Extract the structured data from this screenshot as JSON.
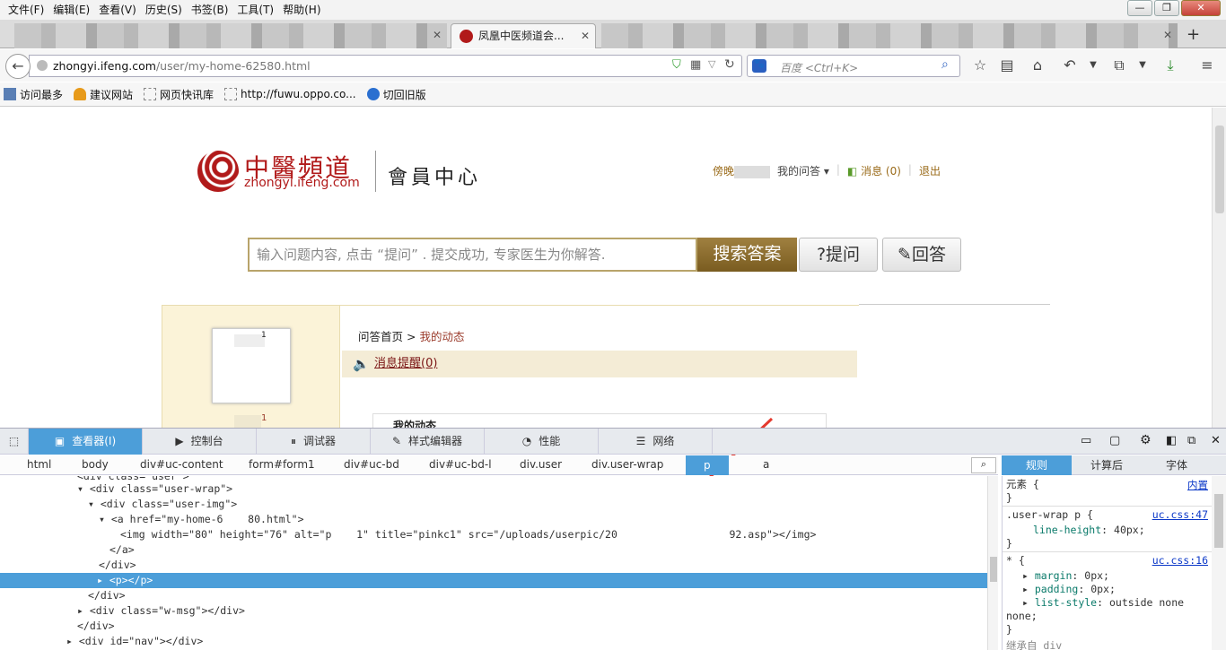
{
  "menubar": {
    "items": [
      "文件(F)",
      "编辑(E)",
      "查看(V)",
      "历史(S)",
      "书签(B)",
      "工具(T)",
      "帮助(H)"
    ]
  },
  "tabs": {
    "active_title": "凤凰中医频道会...",
    "new_tab": "+"
  },
  "navbar": {
    "url_host": "zhongyi.ifeng.com",
    "url_path": "/user/my-home-62580.html",
    "search_placeholder": "百度 <Ctrl+K>"
  },
  "bookmarks": [
    "访问最多",
    "建议网站",
    "网页快讯库",
    "http://fuwu.oppo.co...",
    "切回旧版"
  ],
  "page": {
    "logo_cn": "中醫頻道",
    "logo_en": "zhongyi.ifeng.com",
    "logo_section": "會員中心",
    "user_prefix": "傍晚",
    "my_questions": "我的问答",
    "messages": "消息 (0)",
    "logout": "退出",
    "question_placeholder": "输入问题内容, 点击 “提问” . 提交成功, 专家医生为你解答.",
    "search_btn": "搜索答案",
    "ask_btn": "提问",
    "answer_btn": "回答",
    "crumb_home": "问答首页",
    "crumb_sep": ">",
    "crumb_current": "我的动态",
    "notice_link": "消息提醒",
    "notice_count": "(0)",
    "dynamic_title": "我的动态",
    "avatar_label": "1",
    "name_label": "1"
  },
  "devtools": {
    "tabs": [
      "查看器(I)",
      "控制台",
      "调试器",
      "样式编辑器",
      "性能",
      "网络"
    ],
    "breadcrumbs": [
      "html",
      "body",
      "div#uc-content",
      "form#form1",
      "div#uc-bd",
      "div#uc-bd-l",
      "div.user",
      "div.user-wrap",
      "p",
      "a"
    ],
    "markup": [
      {
        "text": "<div class=\"user\">"
      },
      {
        "text": "<div class=\"user-wrap\">"
      },
      {
        "text": "<div class=\"user-img\">"
      },
      {
        "text": "<a href=\"my-home-6    80.html\">"
      },
      {
        "text": "<img width=\"80\" height=\"76\" alt=\"p    1\" title=\"pinkc1\" src=\"/uploads/userpic/20                  92.asp\"></img>"
      },
      {
        "text": "</a>"
      },
      {
        "text": "</div>"
      },
      {
        "text": "<p></p>"
      },
      {
        "text": "</div>"
      },
      {
        "text": "<div class=\"w-msg\"></div>"
      },
      {
        "text": "</div>"
      },
      {
        "text": "<div id=\"nav\"></div>"
      }
    ],
    "side_tabs": [
      "规则",
      "计算后",
      "字体"
    ],
    "rules": {
      "element_label": "元素 {",
      "inline": "内置",
      "close": "}",
      "rule1_selector": ".user-wrap p {",
      "rule1_src": "uc.css:47",
      "rule1_prop": "line-height",
      "rule1_val": "40px;",
      "rule2_selector": "* {",
      "rule2_src": "uc.css:16",
      "rule2_props": [
        {
          "p": "margin",
          "v": "0px;"
        },
        {
          "p": "padding",
          "v": "0px;"
        },
        {
          "p": "list-style",
          "v": "outside none"
        }
      ],
      "rule2_cont": "none;",
      "inherited": "继承自 div"
    }
  },
  "colors": {
    "accent": "#4c9ed9",
    "brand": "#b11a1a",
    "gold": "#8a6a28"
  }
}
